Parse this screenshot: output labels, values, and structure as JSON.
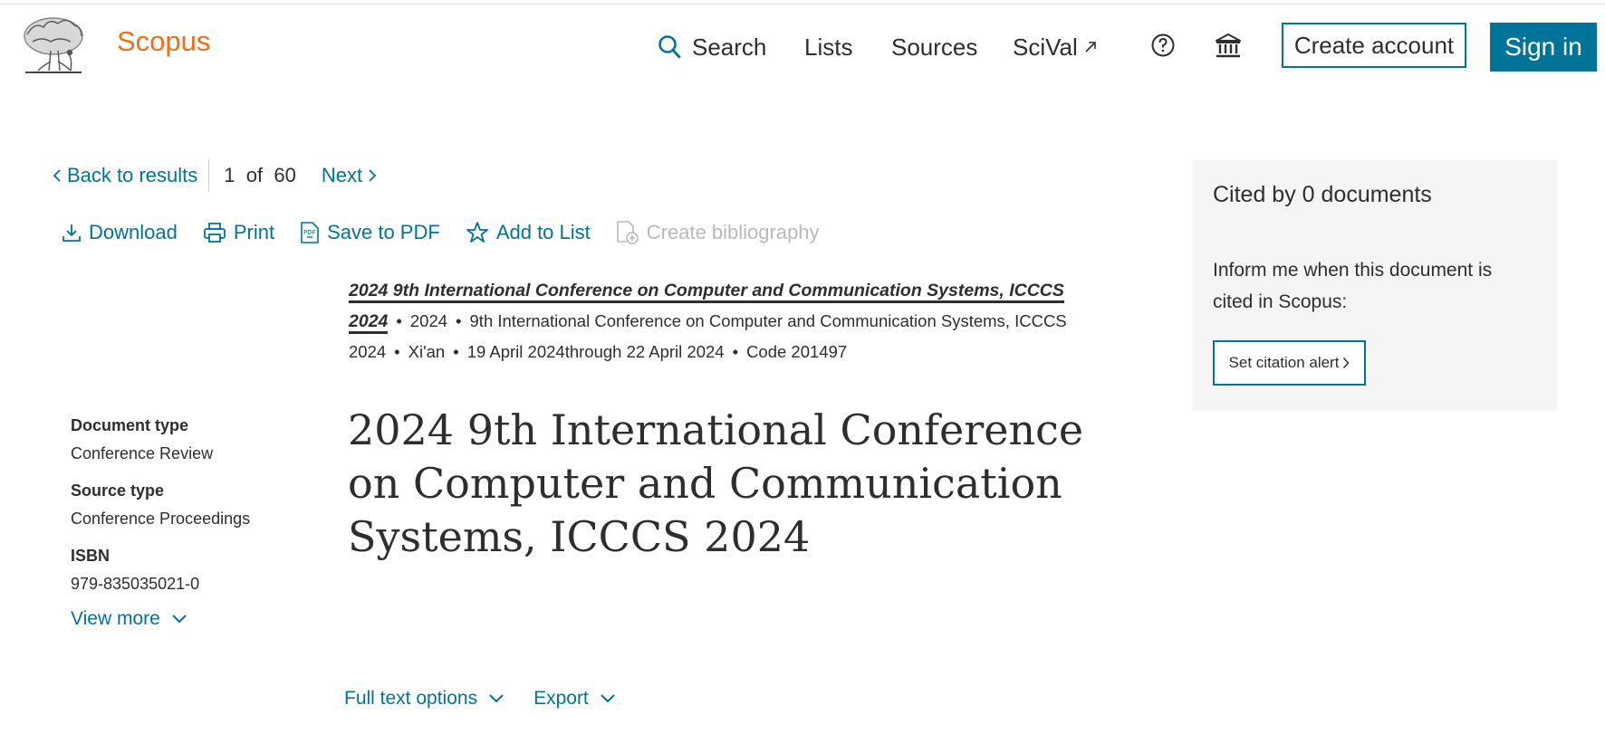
{
  "header": {
    "brand": "Scopus",
    "nav": {
      "search": "Search",
      "lists": "Lists",
      "sources": "Sources",
      "scival": "SciVal"
    },
    "create_account": "Create account",
    "sign_in": "Sign in"
  },
  "results_nav": {
    "back": "Back to results",
    "current": "1",
    "of": "of",
    "total": "60",
    "next": "Next"
  },
  "toolbar": {
    "download": "Download",
    "print": "Print",
    "save_pdf": "Save to PDF",
    "add_list": "Add to List",
    "bibliography": "Create bibliography"
  },
  "source": {
    "title": "2024 9th International Conference on Computer and Communication Systems, ICCCS 2024",
    "year": "2024",
    "conference": "9th International Conference on Computer and Communication Systems, ICCCS 2024",
    "location": "Xi'an",
    "dates": "19 April 2024through 22 April 2024",
    "code": "Code 201497"
  },
  "meta": {
    "doc_type_label": "Document type",
    "doc_type": "Conference Review",
    "source_type_label": "Source type",
    "source_type": "Conference Proceedings",
    "isbn_label": "ISBN",
    "isbn": "979-835035021-0",
    "view_more": "View more"
  },
  "document_title": "2024 9th International Conference on Computer and Communication Systems, ICCCS 2024",
  "options": {
    "full_text": "Full text options",
    "export": "Export"
  },
  "cited": {
    "title": "Cited by 0 documents",
    "text": "Inform me when this document is cited in Scopus:",
    "alert_button": "Set citation alert"
  },
  "colors": {
    "brand": "#e9711c",
    "link": "#007398",
    "text": "#2e2e2e",
    "panel": "#f5f5f5"
  }
}
